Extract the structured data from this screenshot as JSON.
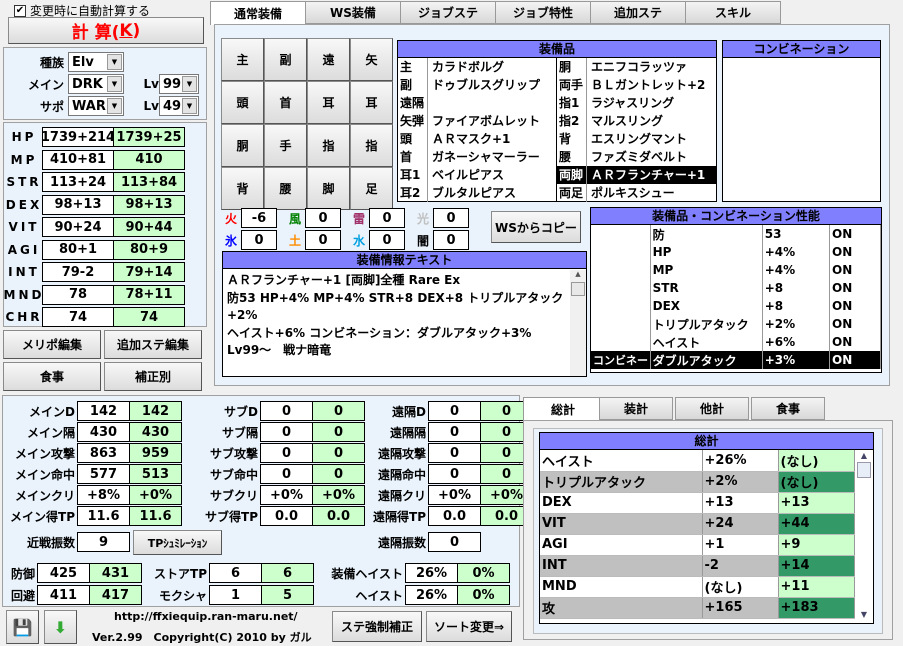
{
  "auto_calc": {
    "label": "変更時に自動計算する",
    "checked": true
  },
  "calc_button": {
    "label": "計 算(",
    "key": "K",
    "end": ")"
  },
  "char": {
    "race_label": "種族",
    "race": "Elv",
    "main_label": "メイン",
    "main_job": "DRK",
    "sub_label": "サポ",
    "sub_job": "WAR",
    "lv_label": "Lv",
    "main_lv": "99",
    "sub_lv": "49"
  },
  "stats": [
    {
      "name": "HP",
      "a": "1739+214",
      "b": "1739+25"
    },
    {
      "name": "MP",
      "a": "410+81",
      "b": "410"
    },
    {
      "name": "STR",
      "a": "113+24",
      "b": "113+84"
    },
    {
      "name": "DEX",
      "a": "98+13",
      "b": "98+13"
    },
    {
      "name": "VIT",
      "a": "90+24",
      "b": "90+44"
    },
    {
      "name": "AGI",
      "a": "80+1",
      "b": "80+9"
    },
    {
      "name": "INT",
      "a": "79-2",
      "b": "79+14"
    },
    {
      "name": "MND",
      "a": "78",
      "b": "78+11"
    },
    {
      "name": "CHR",
      "a": "74",
      "b": "74"
    }
  ],
  "left_buttons": [
    "メリポ編集",
    "追加ステ編集",
    "食事",
    "補正別"
  ],
  "top_tabs": [
    "通常装備",
    "WS装備",
    "ジョブステ",
    "ジョブ特性",
    "追加ステ",
    "スキル"
  ],
  "slot_buttons": [
    "主",
    "副",
    "遠",
    "矢",
    "頭",
    "首",
    "耳",
    "耳",
    "胴",
    "手",
    "指",
    "指",
    "背",
    "腰",
    "脚",
    "足"
  ],
  "equipment": {
    "title": "装備品",
    "left": [
      [
        "主",
        "カラドボルグ"
      ],
      [
        "副",
        "ドゥブルスグリップ"
      ],
      [
        "遠隔",
        ""
      ],
      [
        "矢弾",
        "ファイアボムレット"
      ],
      [
        "頭",
        "ＡＲマスク+1"
      ],
      [
        "首",
        "ガネーシャマーラー"
      ],
      [
        "耳1",
        "ベイルピアス"
      ],
      [
        "耳2",
        "ブルタルピアス"
      ]
    ],
    "right": [
      [
        "胴",
        "エニフコラッツァ"
      ],
      [
        "両手",
        "ＢＬガントレット+2"
      ],
      [
        "指1",
        "ラジャスリング"
      ],
      [
        "指2",
        "マルスリング"
      ],
      [
        "背",
        "エスリングマント"
      ],
      [
        "腰",
        "ファズミダベルト"
      ],
      [
        "両脚",
        "ＡＲフランチャー+1"
      ],
      [
        "両足",
        "ポルキスシュー"
      ]
    ],
    "selected": "両脚"
  },
  "combination": {
    "title": "コンビネーション"
  },
  "elements": [
    {
      "name": "火",
      "value": "-6",
      "color": "#ff0000"
    },
    {
      "name": "風",
      "value": "0",
      "color": "#008000"
    },
    {
      "name": "雷",
      "value": "0",
      "color": "#a0306a"
    },
    {
      "name": "光",
      "value": "0",
      "color": "#c0c0c0"
    },
    {
      "name": "氷",
      "value": "0",
      "color": "#0000ff"
    },
    {
      "name": "土",
      "value": "0",
      "color": "#ff8c00"
    },
    {
      "name": "水",
      "value": "0",
      "color": "#00a0e0"
    },
    {
      "name": "闇",
      "value": "0",
      "color": "#000000"
    }
  ],
  "ws_copy_button": "WSからコピー",
  "info_text": {
    "title": "装備情報テキスト",
    "lines": [
      "ＡＲフランチャー+1 [両脚]全種 Rare Ex",
      "防53 HP+4% MP+4% STR+8 DEX+8 トリプルアタック",
      "+2%",
      "ヘイスト+6% コンビネーション：ダブルアタック+3%",
      "Lv99～　戦ナ暗竜"
    ]
  },
  "performance": {
    "title": "装備品・コンビネーション性能",
    "rows": [
      [
        "",
        "防",
        "53",
        "ON"
      ],
      [
        "",
        "HP",
        "+4%",
        "ON"
      ],
      [
        "",
        "MP",
        "+4%",
        "ON"
      ],
      [
        "",
        "STR",
        "+8",
        "ON"
      ],
      [
        "",
        "DEX",
        "+8",
        "ON"
      ],
      [
        "",
        "トリプルアタック",
        "+2%",
        "ON"
      ],
      [
        "",
        "ヘイスト",
        "+6%",
        "ON"
      ],
      [
        "コンビネー",
        "ダブルアタック",
        "+3%",
        "ON"
      ]
    ]
  },
  "combat": {
    "cols": [
      [
        [
          "メインD",
          "142",
          "142"
        ],
        [
          "メイン隔",
          "430",
          "430"
        ],
        [
          "メイン攻撃",
          "863",
          "959"
        ],
        [
          "メイン命中",
          "577",
          "513"
        ],
        [
          "メインクリ",
          "+8%",
          "+0%"
        ],
        [
          "メイン得TP",
          "11.6",
          "11.6"
        ]
      ],
      [
        [
          "サブD",
          "0",
          "0"
        ],
        [
          "サブ隔",
          "0",
          "0"
        ],
        [
          "サブ攻撃",
          "0",
          "0"
        ],
        [
          "サブ命中",
          "0",
          "0"
        ],
        [
          "サブクリ",
          "+0%",
          "+0%"
        ],
        [
          "サブ得TP",
          "0.0",
          "0.0"
        ]
      ],
      [
        [
          "遠隔D",
          "0",
          "0"
        ],
        [
          "遠隔隔",
          "0",
          "0"
        ],
        [
          "遠隔攻撃",
          "0",
          "0"
        ],
        [
          "遠隔命中",
          "0",
          "0"
        ],
        [
          "遠隔クリ",
          "+0%",
          "+0%"
        ],
        [
          "遠隔得TP",
          "0.0",
          "0.0"
        ]
      ]
    ],
    "melee_swings_label": "近戦振数",
    "melee_swings": "9",
    "tp_sim_button": "TPｼｭﾐﾚｰｼｮﾝ",
    "ranged_swings_label": "遠隔振数",
    "ranged_swings": "0",
    "defense": [
      [
        "防御",
        "425",
        "431"
      ],
      [
        "回避",
        "411",
        "417"
      ]
    ],
    "store": [
      [
        "ストアTP",
        "6",
        "6"
      ],
      [
        "モクシャ",
        "1",
        "5"
      ]
    ],
    "haste": [
      [
        "装備ヘイスト",
        "26%",
        "0%"
      ],
      [
        "ヘイスト",
        "26%",
        "0%"
      ]
    ]
  },
  "footer": {
    "url": "http://ffxiequip.ran-maru.net/",
    "version": "Ver.2.99　Copyright(C) 2010 by ガル",
    "force_button": "ステ強制補正",
    "sort_button": "ソート変更⇒"
  },
  "total_tabs": [
    "総計",
    "装計",
    "他計",
    "食事"
  ],
  "totals": {
    "title": "総計",
    "rows": [
      [
        "ヘイスト",
        "+26%",
        "(なし)"
      ],
      [
        "トリプルアタック",
        "+2%",
        "(なし)"
      ],
      [
        "DEX",
        "+13",
        "+13"
      ],
      [
        "VIT",
        "+24",
        "+44"
      ],
      [
        "AGI",
        "+1",
        "+9"
      ],
      [
        "INT",
        "-2",
        "+14"
      ],
      [
        "MND",
        "(なし)",
        "+11"
      ],
      [
        "攻",
        "+165",
        "+183"
      ]
    ]
  }
}
